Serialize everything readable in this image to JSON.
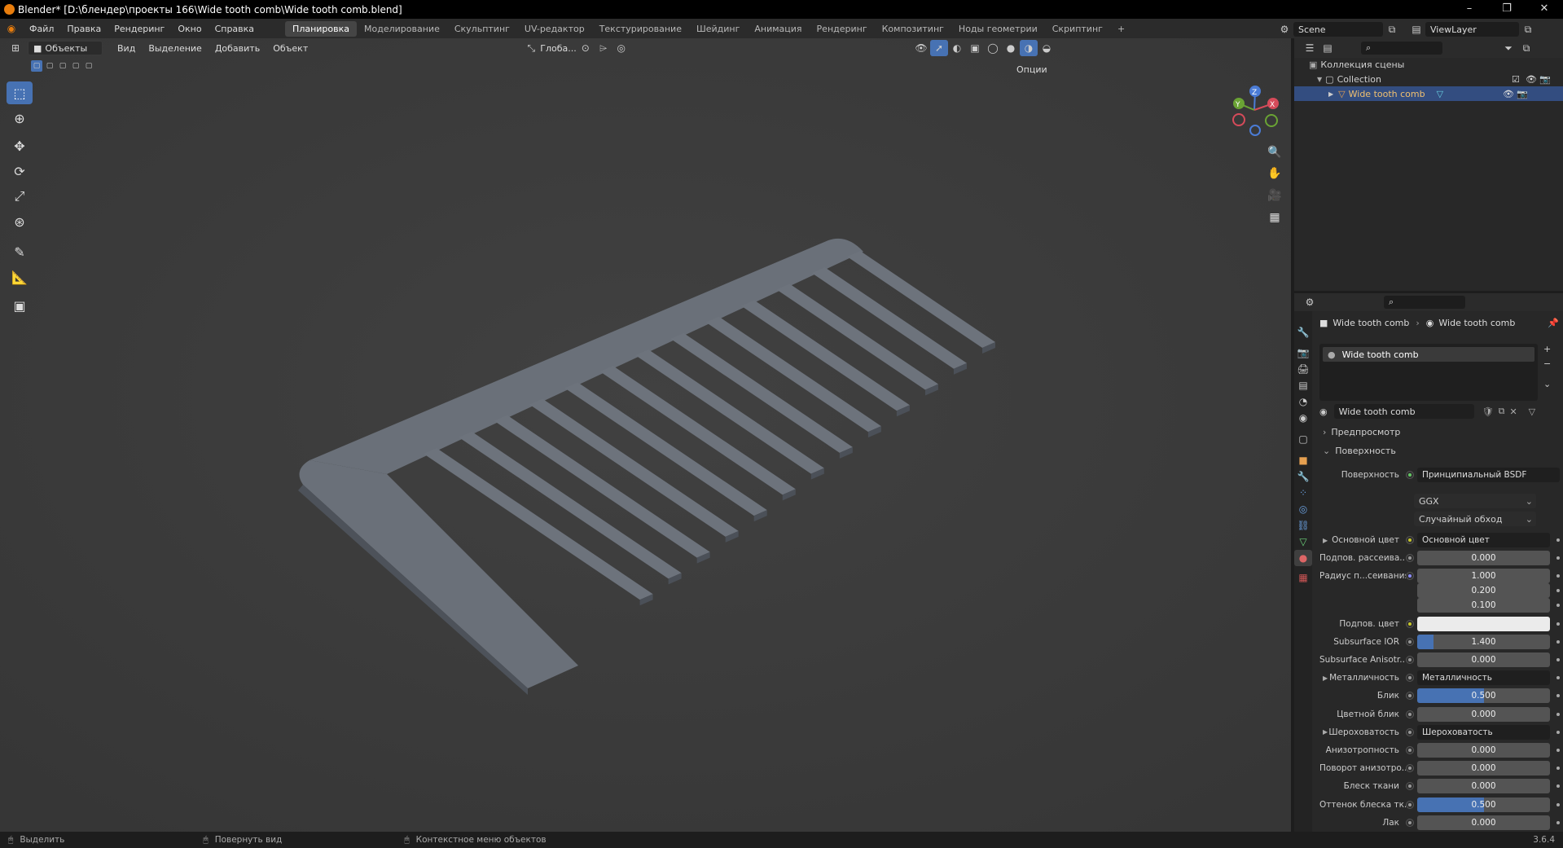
{
  "title": "Blender* [D:\\блендер\\проекты 166\\Wide tooth comb\\Wide tooth comb.blend]",
  "window_controls": {
    "minimize": "–",
    "maximize": "❐",
    "close": "✕"
  },
  "menus": [
    "Файл",
    "Правка",
    "Рендеринг",
    "Окно",
    "Справка"
  ],
  "workspaces": [
    "Планировка",
    "Моделирование",
    "Скульптинг",
    "UV-редактор",
    "Текстурирование",
    "Шейдинг",
    "Анимация",
    "Рендеринг",
    "Композитинг",
    "Ноды геометрии",
    "Скриптинг",
    "+"
  ],
  "active_workspace": "Планировка",
  "scene": "Scene",
  "viewlayer": "ViewLayer",
  "viewport": {
    "mode": "Объекты",
    "menus": [
      "Вид",
      "Выделение",
      "Добавить",
      "Объект"
    ],
    "orientation": "Глоба...",
    "options": "Опции",
    "gizmo": {
      "x": "X",
      "y": "Y",
      "z": "Z"
    }
  },
  "outliner": {
    "root": "Коллекция сцены",
    "collection": "Collection",
    "object": "Wide tooth comb"
  },
  "properties": {
    "breadcrumb_object": "Wide tooth comb",
    "breadcrumb_material": "Wide tooth comb",
    "slot": "Wide tooth comb",
    "material_name": "Wide tooth comb",
    "preview_label": "Предпросмотр",
    "surface_label": "Поверхность",
    "surface_row": {
      "label": "Поверхность",
      "value": "Принципиальный BSDF"
    },
    "distribution": "GGX",
    "subsurface_method": "Случайный обход",
    "rows": [
      {
        "label": "Основной цвет",
        "type": "link",
        "value": "Основной цвет",
        "dot": "yellow",
        "expand": true
      },
      {
        "label": "Подпов. рассеива...",
        "type": "num",
        "value": "0.000",
        "dot": "gray"
      },
      {
        "label": "Радиус п...сеивания",
        "type": "num",
        "value": "1.000",
        "dot": "purple"
      },
      {
        "label": "",
        "type": "num",
        "value": "0.200",
        "dot": "none"
      },
      {
        "label": "",
        "type": "num",
        "value": "0.100",
        "dot": "none"
      },
      {
        "label": "Подпов. цвет",
        "type": "color",
        "value": "#ebebeb",
        "dot": "yellow"
      },
      {
        "label": "Subsurface IOR",
        "type": "num",
        "value": "1.400",
        "dot": "gray",
        "fill": 0.12
      },
      {
        "label": "Subsurface Anisotr...",
        "type": "num",
        "value": "0.000",
        "dot": "gray"
      },
      {
        "label": "Металличность",
        "type": "link",
        "value": "Металличность",
        "dot": "gray",
        "expand": true
      },
      {
        "label": "Блик",
        "type": "num",
        "value": "0.500",
        "dot": "gray",
        "fill": 0.5
      },
      {
        "label": "Цветной блик",
        "type": "num",
        "value": "0.000",
        "dot": "gray"
      },
      {
        "label": "Шероховатость",
        "type": "link",
        "value": "Шероховатость",
        "dot": "gray",
        "expand": true
      },
      {
        "label": "Анизотропность",
        "type": "num",
        "value": "0.000",
        "dot": "gray"
      },
      {
        "label": "Поворот анизотро...",
        "type": "num",
        "value": "0.000",
        "dot": "gray"
      },
      {
        "label": "Блеск ткани",
        "type": "num",
        "value": "0.000",
        "dot": "gray"
      },
      {
        "label": "Оттенок блеска тк...",
        "type": "num",
        "value": "0.500",
        "dot": "gray",
        "fill": 0.5
      },
      {
        "label": "Лак",
        "type": "num",
        "value": "0.000",
        "dot": "gray"
      }
    ]
  },
  "statusbar": {
    "select": "Выделить",
    "rotate": "Повернуть вид",
    "context": "Контекстное меню объектов",
    "version": "3.6.4"
  }
}
